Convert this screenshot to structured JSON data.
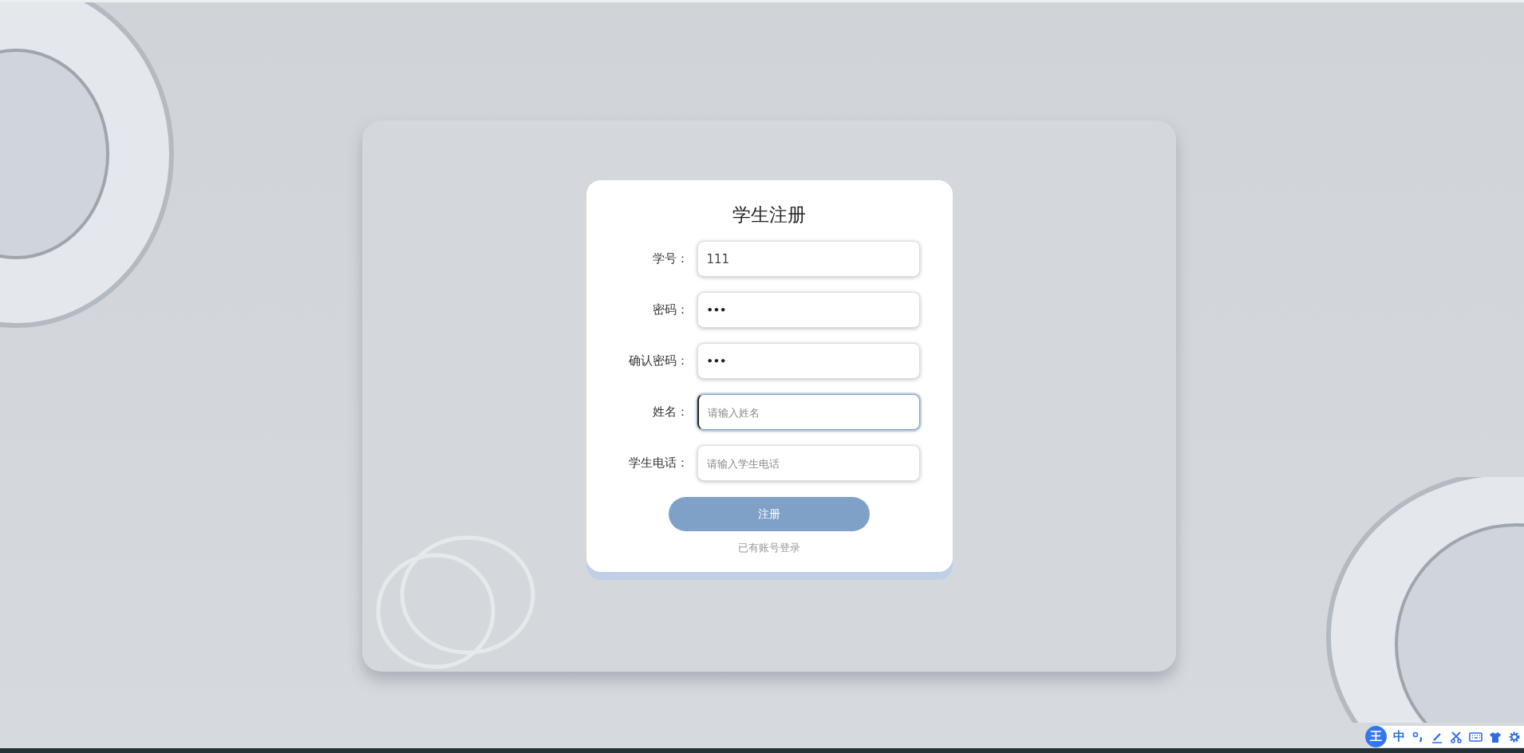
{
  "form": {
    "title": "学生注册",
    "fields": [
      {
        "label": "学号：",
        "kind": "text",
        "value": "111"
      },
      {
        "label": "密码：",
        "kind": "password",
        "value": "•••"
      },
      {
        "label": "确认密码：",
        "kind": "password",
        "value": "•••"
      },
      {
        "label": "姓名：",
        "kind": "text",
        "placeholder": "请输入姓名",
        "focused": true
      },
      {
        "label": "学生电话：",
        "kind": "text",
        "placeholder": "请输入学生电话",
        "focused": false
      }
    ],
    "submit": "注册",
    "login_link": "已有账号登录"
  },
  "ime_toolbar": {
    "logo": "王",
    "mode": "中"
  }
}
